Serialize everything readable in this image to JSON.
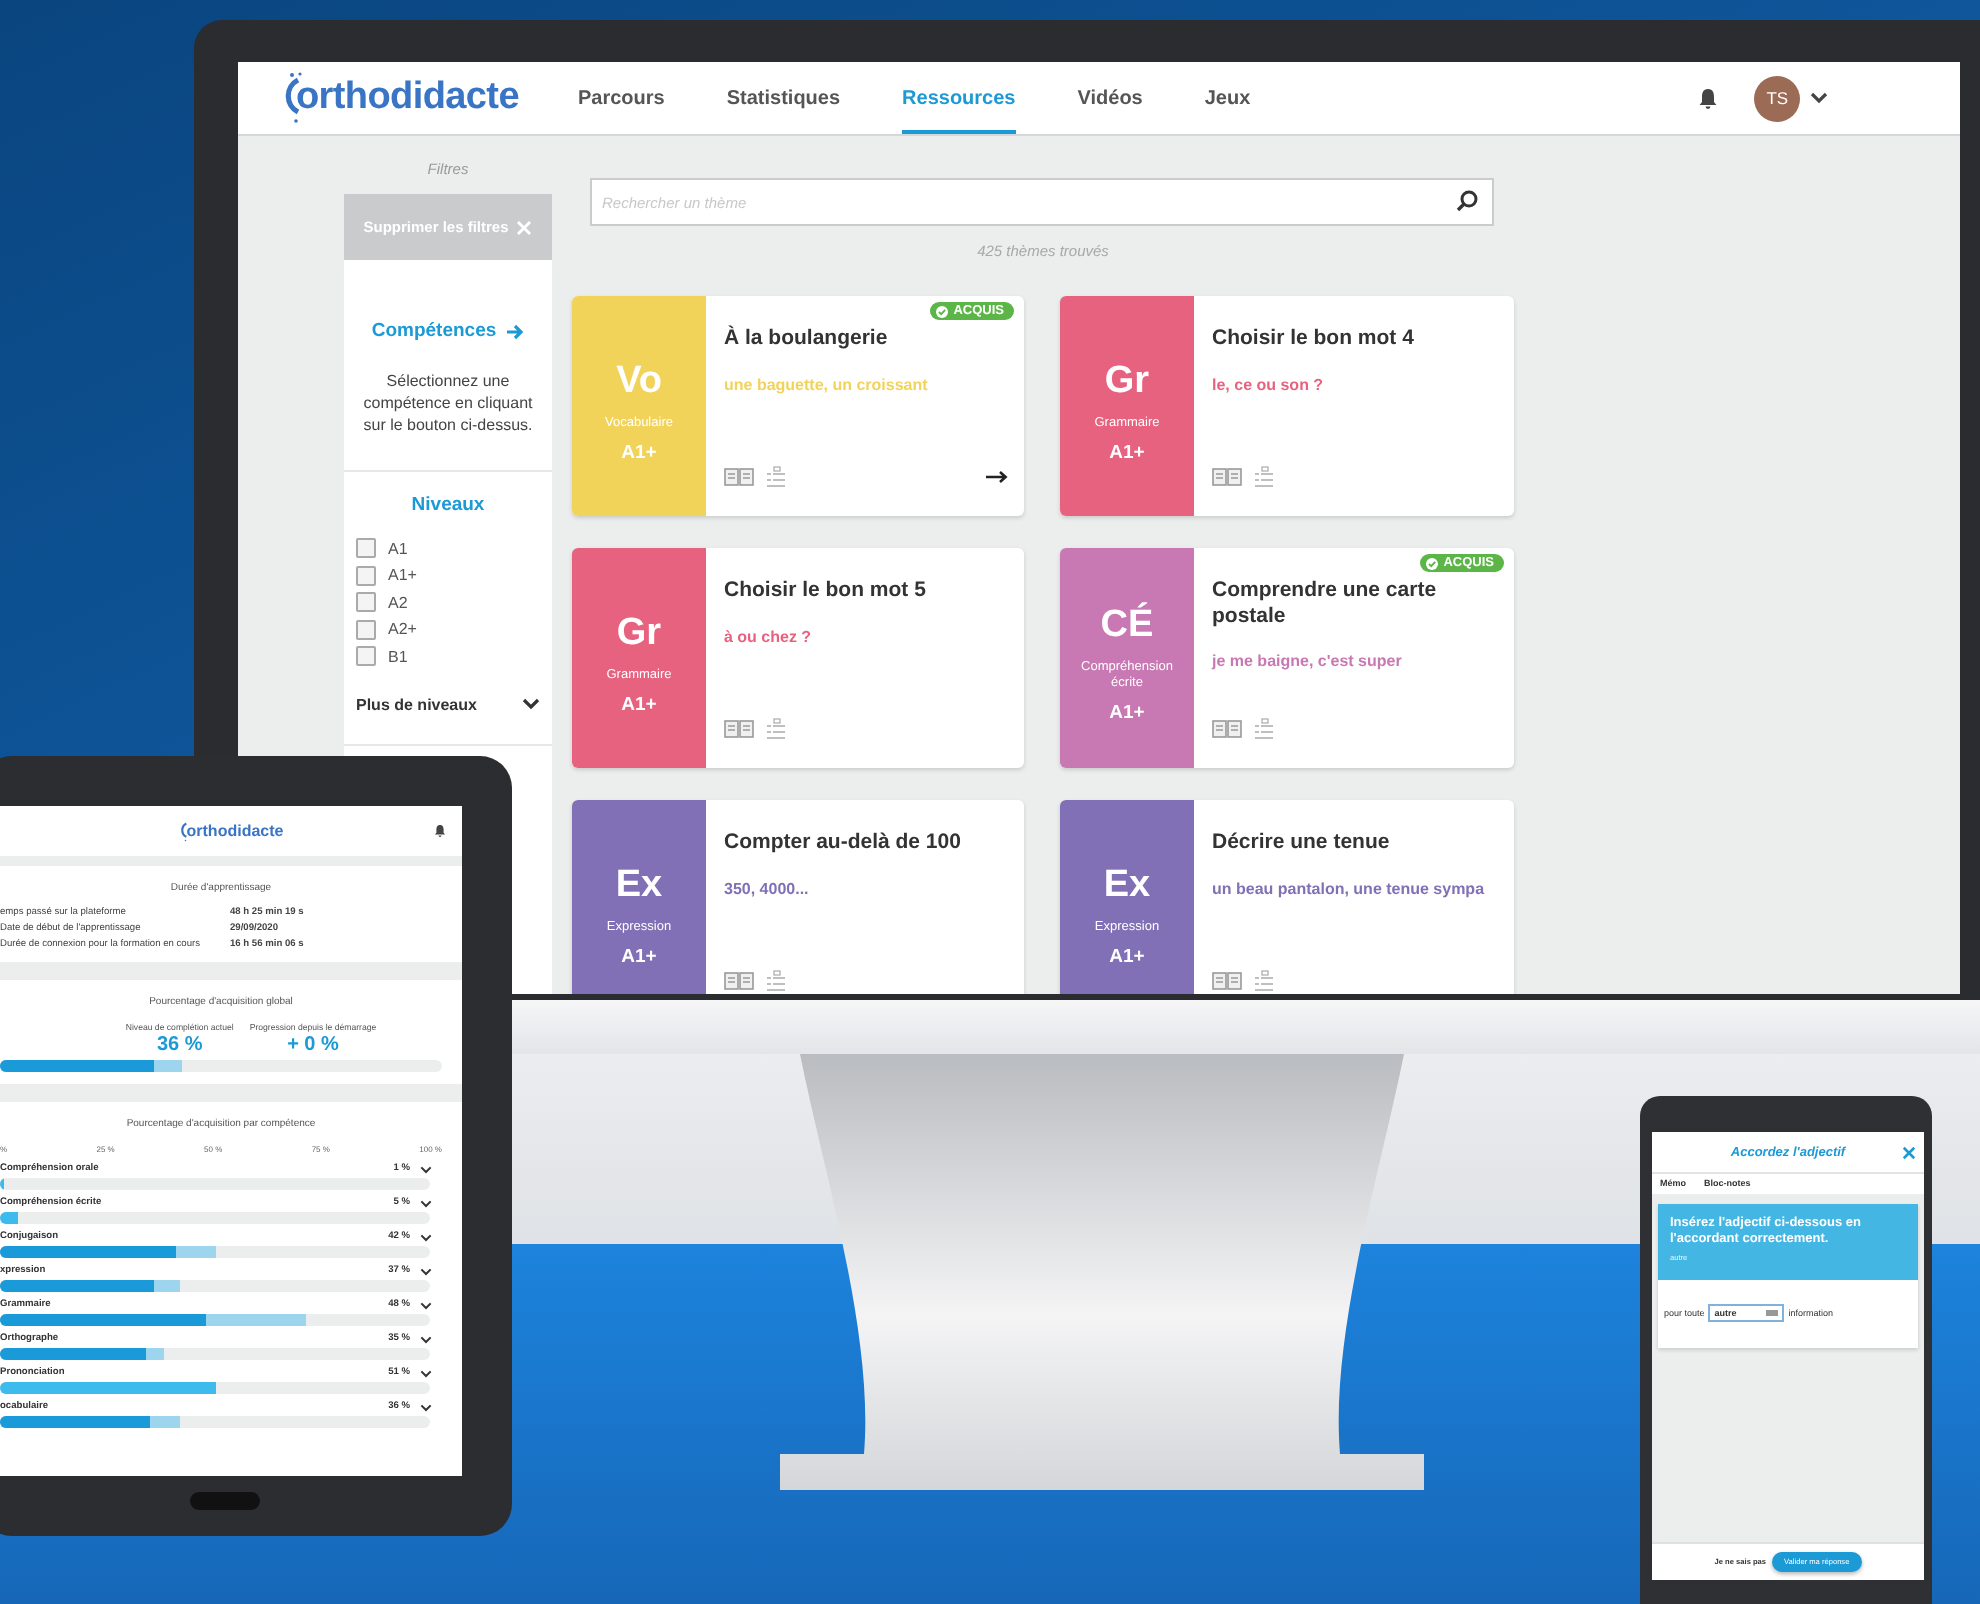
{
  "monitor": {
    "logo": "orthodidacte",
    "nav": [
      {
        "label": "Parcours",
        "selected": false
      },
      {
        "label": "Statistiques",
        "selected": false
      },
      {
        "label": "Ressources",
        "selected": true
      },
      {
        "label": "Vidéos",
        "selected": false
      },
      {
        "label": "Jeux",
        "selected": false
      }
    ],
    "avatar": "TS",
    "sidebar": {
      "title": "Filtres",
      "clear_button": "Supprimer les filtres",
      "competences_link": "Compétences",
      "competences_hint": "Sélectionnez une compétence en cliquant sur le bouton ci-dessus.",
      "levels_title": "Niveaux",
      "levels": [
        {
          "label": "A1",
          "checked": false
        },
        {
          "label": "A1+",
          "checked": false
        },
        {
          "label": "A2",
          "checked": false
        },
        {
          "label": "A2+",
          "checked": false
        },
        {
          "label": "B1",
          "checked": false
        }
      ],
      "more_levels": "Plus de niveaux"
    },
    "search": {
      "placeholder": "Rechercher un thème"
    },
    "results_count": "425 thèmes trouvés",
    "cards": [
      {
        "code": "Vo",
        "category": "Vocabulaire",
        "grade": "A1+",
        "title": "À la boulangerie",
        "subtitle": "une baguette, un croissant",
        "color": "#f2d35a",
        "badge": "ACQUIS",
        "show_arrow": true
      },
      {
        "code": "Gr",
        "category": "Grammaire",
        "grade": "A1+",
        "title": "Choisir le bon mot 4",
        "subtitle": "le, ce ou son ?",
        "color": "#e7627f",
        "show_arrow": false
      },
      {
        "code": "Gr",
        "category": "Grammaire",
        "grade": "A1+",
        "title": "Choisir le bon mot 5",
        "subtitle": "à ou chez ?",
        "color": "#e7627f",
        "show_arrow": false
      },
      {
        "code": "CÉ",
        "category": "Compréhension écrite",
        "grade": "A1+",
        "title": "Comprendre une carte postale",
        "subtitle": "je me baigne, c'est super",
        "color": "#c878b2",
        "badge": "ACQUIS",
        "show_arrow": false
      },
      {
        "code": "Ex",
        "category": "Expression",
        "grade": "A1+",
        "title": "Compter au-delà de 100",
        "subtitle": "350, 4000...",
        "color": "#8170b6",
        "show_arrow": false
      },
      {
        "code": "Ex",
        "category": "Expression",
        "grade": "A1+",
        "title": "Décrire une tenue",
        "subtitle": "un beau pantalon, une tenue sympa",
        "color": "#8170b6",
        "show_arrow": false
      }
    ]
  },
  "tablet": {
    "logo": "orthodidacte",
    "duration": {
      "title": "Durée d'apprentissage",
      "rows": [
        {
          "label": "emps passé sur la plateforme",
          "value": "48 h 25 min 19 s"
        },
        {
          "label": "Date de début de l'apprentissage",
          "value": "29/09/2020"
        },
        {
          "label": "Durée de connexion pour la formation en cours",
          "value": "16 h 56 min 06 s"
        }
      ]
    },
    "global": {
      "title": "Pourcentage d'acquisition global",
      "current_label": "Niveau de complétion actuel",
      "current_value": "36 %",
      "progress_label": "Progression depuis le démarrage",
      "progress_value": "+ 0 %",
      "bar": {
        "level": 0.35
      },
      "target": {
        "level": 0.41
      }
    },
    "by_skill": {
      "title": "Pourcentage d'acquisition par compétence",
      "ticks": [
        "%",
        "25 %",
        "50 %",
        "75 %",
        "100 %"
      ],
      "rows": [
        {
          "name": "Compréhension orale",
          "value": "1 %",
          "bar": {
            "level": 0.01
          }
        },
        {
          "name": "Compréhension écrite",
          "value": "5 %",
          "bar": {
            "level": 0.04
          }
        },
        {
          "name": "Conjugaison",
          "value": "42 %",
          "bar": {
            "level": 0.41
          },
          "target": {
            "level": 0.5
          }
        },
        {
          "name": "xpression",
          "value": "37 %",
          "bar": {
            "level": 0.36
          },
          "target": {
            "level": 0.42
          }
        },
        {
          "name": "Grammaire",
          "value": "48 %",
          "bar": {
            "level": 0.48
          },
          "target": {
            "level": 0.71
          }
        },
        {
          "name": "Orthographe",
          "value": "35 %",
          "bar": {
            "level": 0.34
          },
          "target": {
            "level": 0.38
          }
        },
        {
          "name": "Prononciation",
          "value": "51 %",
          "bar": {
            "level": 0.5
          }
        },
        {
          "name": "ocabulaire",
          "value": "36 %",
          "bar": {
            "level": 0.35
          },
          "target": {
            "level": 0.42
          }
        }
      ]
    }
  },
  "phone": {
    "title": "Accordez l'adjectif",
    "tabs": [
      "Mémo",
      "Bloc-notes"
    ],
    "instruction": "Insérez l'adjectif ci-dessous en l'accordant correctement.",
    "hint": "autre",
    "sentence_before": "pour toute",
    "answer": "autre",
    "sentence_after": "information",
    "skip": "Je ne sais pas",
    "submit": "Valider ma réponse"
  }
}
